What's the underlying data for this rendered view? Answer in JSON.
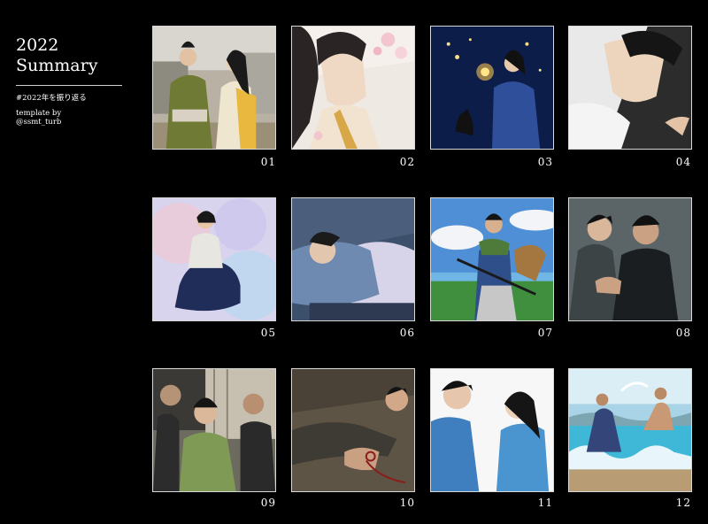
{
  "sidebar": {
    "title": "2022\nSummary",
    "hashtag": "#2022年を振り返る",
    "credit": "template by\n@ssmt_turb"
  },
  "tiles": [
    {
      "number": "01",
      "icon": "artwork-two-figures-kimono-street"
    },
    {
      "number": "02",
      "icon": "artwork-portrait-cherry-blossoms"
    },
    {
      "number": "03",
      "icon": "artwork-night-lantern-cat"
    },
    {
      "number": "04",
      "icon": "artwork-reclining-figure"
    },
    {
      "number": "05",
      "icon": "artwork-seated-figure-watercolor"
    },
    {
      "number": "06",
      "icon": "artwork-sleeping-figure"
    },
    {
      "number": "07",
      "icon": "artwork-samurai-seaside"
    },
    {
      "number": "08",
      "icon": "artwork-two-figures-dark"
    },
    {
      "number": "09",
      "icon": "artwork-group-scene-interior"
    },
    {
      "number": "10",
      "icon": "artwork-bound-figure-floor"
    },
    {
      "number": "11",
      "icon": "artwork-two-figures-bright"
    },
    {
      "number": "12",
      "icon": "artwork-beach-splash"
    }
  ]
}
